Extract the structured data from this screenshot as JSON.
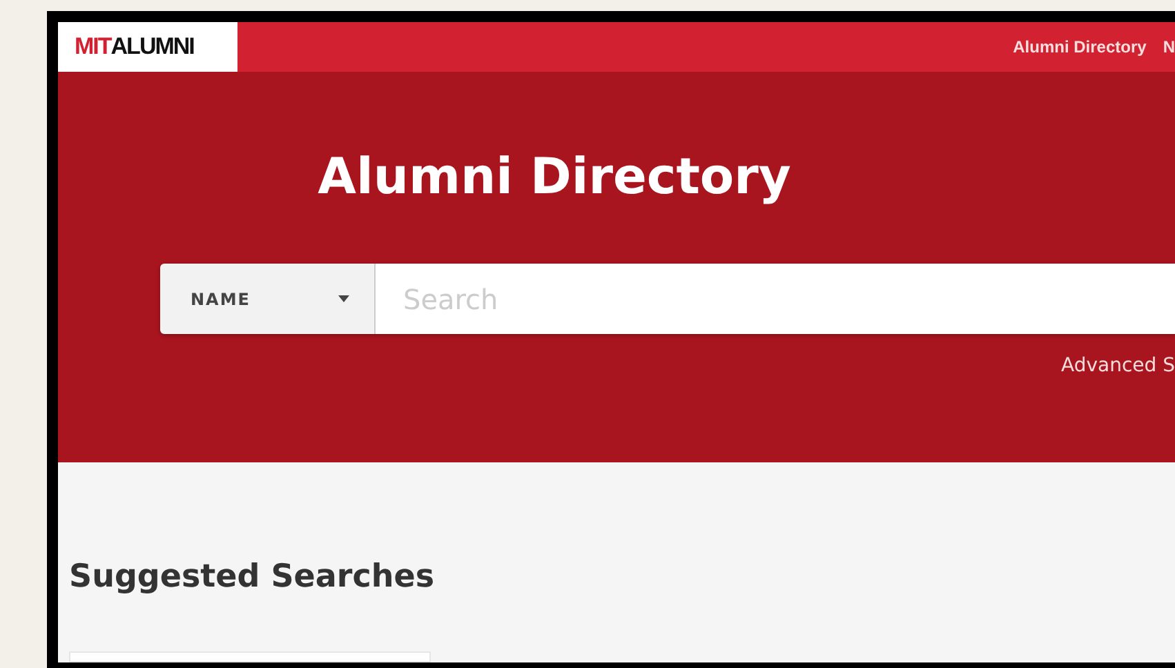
{
  "header": {
    "logo": {
      "part1": "MIT",
      "part2": "ALUMNI"
    },
    "nav": [
      "Alumni Directory",
      "N"
    ]
  },
  "hero": {
    "title": "Alumni Directory",
    "search_type": "NAME",
    "search": {
      "placeholder": "Search"
    },
    "advanced_link": "Advanced S"
  },
  "suggested": {
    "heading": "Suggested Searches"
  }
}
